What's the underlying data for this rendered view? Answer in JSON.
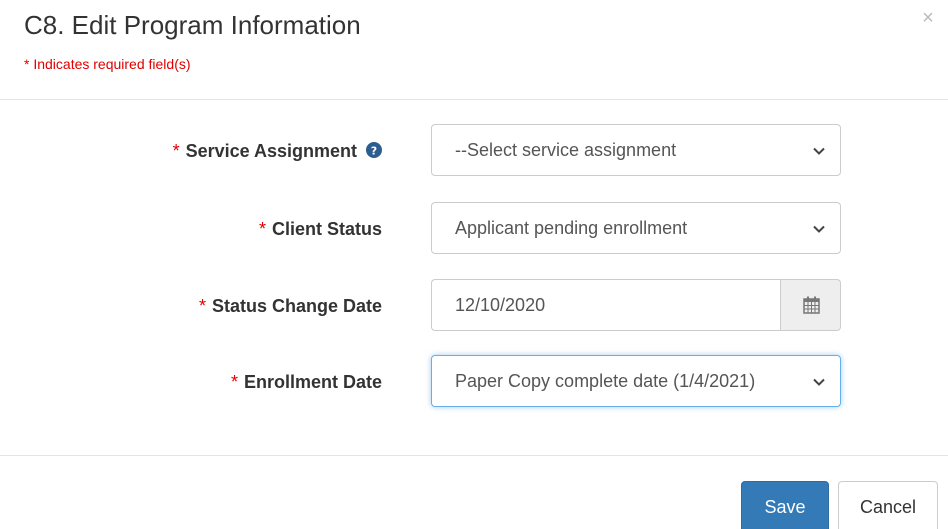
{
  "modal": {
    "title": "C8. Edit Program Information",
    "required_note": "* Indicates required field(s)",
    "close_icon": "×"
  },
  "form": {
    "required_marker": "*",
    "service_assignment": {
      "label": "Service Assignment",
      "value": "--Select service assignment",
      "help_icon": "question-circle-icon"
    },
    "client_status": {
      "label": "Client Status",
      "value": "Applicant pending enrollment"
    },
    "status_change_date": {
      "label": "Status Change Date",
      "value": "12/10/2020",
      "addon_icon": "calendar-icon"
    },
    "enrollment_date": {
      "label": "Enrollment Date",
      "value": "Paper Copy complete date (1/4/2021)"
    }
  },
  "footer": {
    "save_label": "Save",
    "cancel_label": "Cancel"
  },
  "colors": {
    "required": "#e00000",
    "primary": "#337ab7",
    "help_icon": "#2c5d8f",
    "focus": "#66afe9"
  }
}
